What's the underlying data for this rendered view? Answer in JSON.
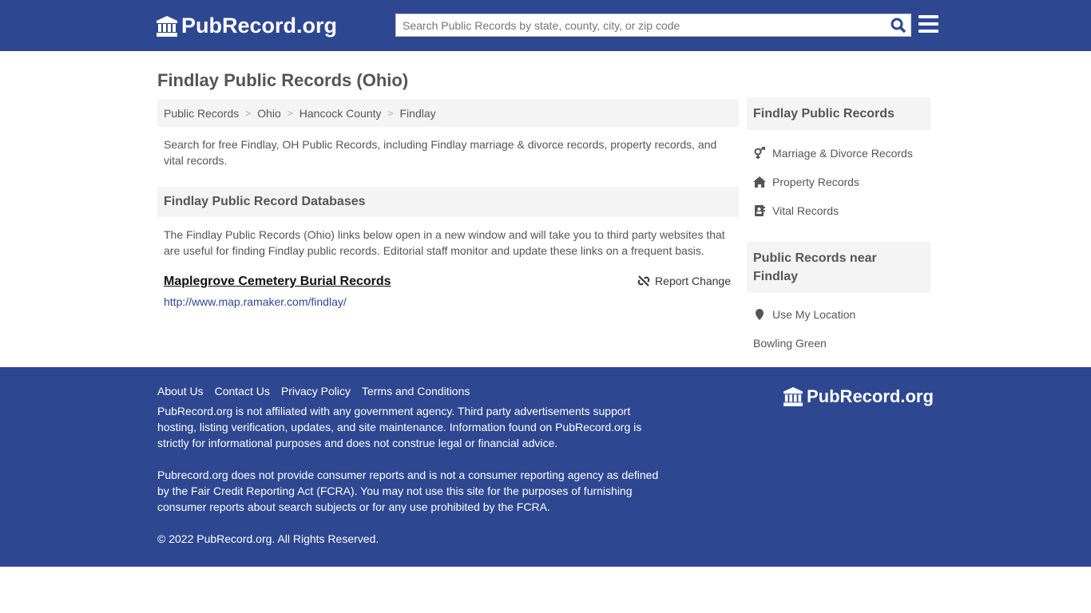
{
  "header": {
    "logo": "PubRecord.org",
    "search_placeholder": "Search Public Records by state, county, city, or zip code"
  },
  "page_title": "Findlay Public Records (Ohio)",
  "breadcrumb": [
    "Public Records",
    "Ohio",
    "Hancock County",
    "Findlay"
  ],
  "intro": "Search for free Findlay, OH Public Records, including Findlay marriage & divorce records, property records, and vital records.",
  "databases": {
    "title": "Findlay Public Record Databases",
    "description": "The Findlay Public Records (Ohio) links below open in a new window and will take you to third party websites that are useful for finding Findlay public records. Editorial staff monitor and update these links on a frequent basis.",
    "records": [
      {
        "title": "Maplegrove Cemetery Burial Records",
        "url": "http://www.map.ramaker.com/findlay/",
        "report": "Report Change"
      }
    ]
  },
  "sidebar": {
    "title": "Findlay Public Records",
    "items": [
      {
        "label": "Marriage & Divorce Records",
        "icon": "venus-mars-icon"
      },
      {
        "label": "Property Records",
        "icon": "home-icon"
      },
      {
        "label": "Vital Records",
        "icon": "address-book-icon"
      }
    ],
    "near_title": "Public Records near Findlay",
    "use_location": "Use My Location",
    "nearby": [
      "Bowling Green"
    ]
  },
  "footer": {
    "links": [
      "About Us",
      "Contact Us",
      "Privacy Policy",
      "Terms and Conditions"
    ],
    "p1": "PubRecord.org is not affiliated with any government agency. Third party advertisements support hosting, listing verification, updates, and site maintenance. Information found on PubRecord.org is strictly for informational purposes and does not construe legal or financial advice.",
    "p2": "Pubrecord.org does not provide consumer reports and is not a consumer reporting agency as defined by the Fair Credit Reporting Act (FCRA). You may not use this site for the purposes of furnishing consumer reports about search subjects or for any use prohibited by the FCRA.",
    "copyright": "© 2022 PubRecord.org. All Rights Reserved.",
    "logo": "PubRecord.org"
  },
  "colors": {
    "brand": "#2e4791",
    "panel": "#f4f4f4"
  }
}
